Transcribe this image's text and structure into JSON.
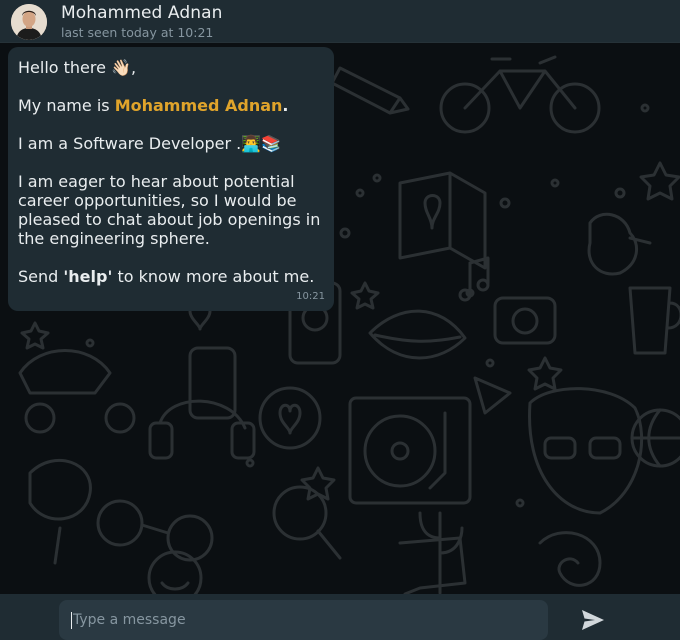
{
  "header": {
    "contact_name": "Mohammed Adnan",
    "last_seen": "last seen today at 10:21"
  },
  "message": {
    "greeting": "Hello there 👋🏻,",
    "intro_prefix": "My name is ",
    "intro_name": "Mohammed Adnan",
    "intro_suffix": ".",
    "role": "I am a Software Developer .👨‍💻📚",
    "opportunities": "I am eager to hear about potential career opportunities, so I would be pleased to chat about job openings in the engineering sphere.",
    "help_prefix": "Send ",
    "help_keyword": "'help'",
    "help_suffix": " to know more about me.",
    "time": "10:21"
  },
  "composer": {
    "placeholder": "Type a message"
  },
  "colors": {
    "header_bg": "#1f2c33",
    "bubble_bg": "#1f2c33",
    "chat_bg": "#0b0f12",
    "highlight": "#e0a42b",
    "text": "#e9edef",
    "muted": "#8696a0"
  }
}
